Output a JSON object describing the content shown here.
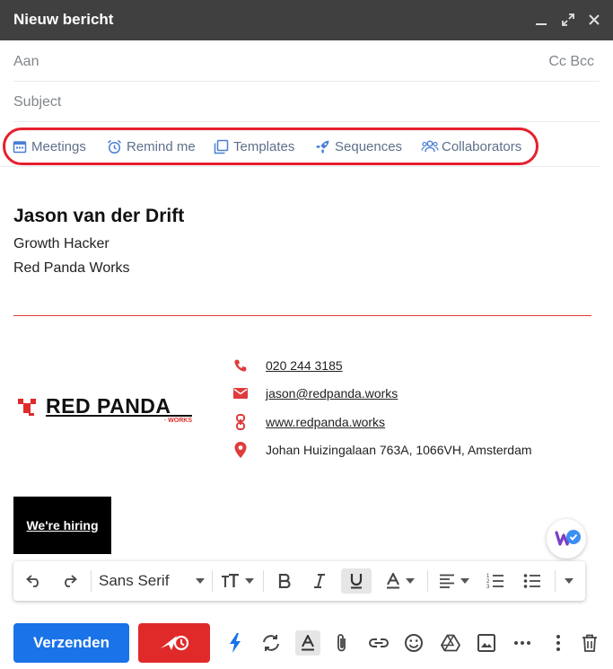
{
  "window": {
    "title": "Nieuw bericht"
  },
  "compose": {
    "to_placeholder": "Aan",
    "cc_label": "Cc",
    "bcc_label": "Bcc",
    "subject_placeholder": "Subject"
  },
  "extension_toolbar": {
    "items": [
      "Meetings",
      "Remind me",
      "Templates",
      "Sequences",
      "Collaborators"
    ],
    "highlight_color": "#e5202e"
  },
  "signature": {
    "name": "Jason van der Drift",
    "role": "Growth Hacker",
    "company": "Red Panda Works",
    "logo_text": "RED PANDA",
    "logo_subtext": "WORKS",
    "phone": "020 244 3185",
    "email": "jason@redpanda.works",
    "website": "www.redpanda.works",
    "address": "Johan Huizingalaan 763A, 1066VH, Amsterdam",
    "banner_text": "We're hiring",
    "accent_color": "#e03b3b"
  },
  "formatting": {
    "font": "Sans Serif"
  },
  "actions": {
    "send_label": "Verzenden",
    "send_color": "#1a73e8",
    "schedule_color": "#e02a2a"
  }
}
